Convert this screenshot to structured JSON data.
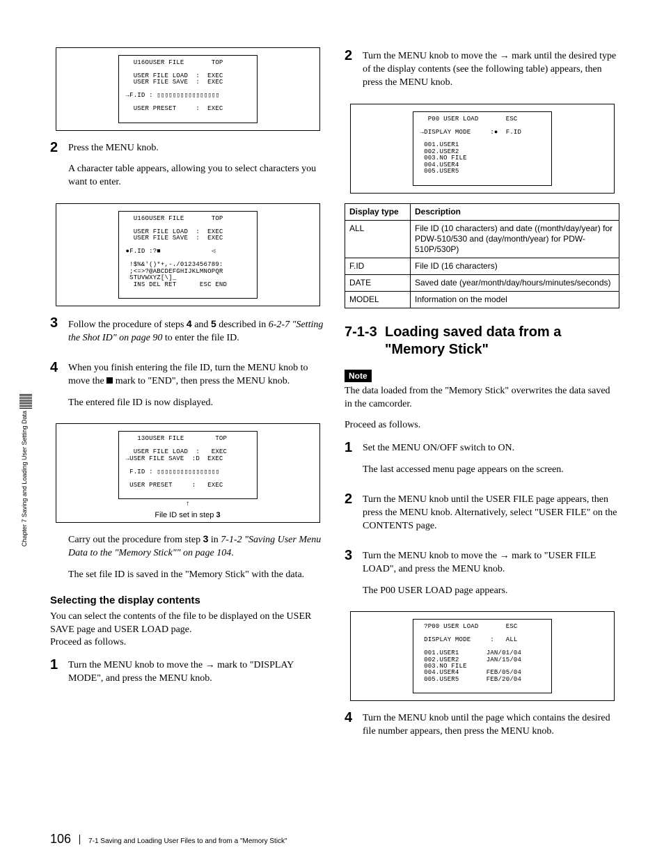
{
  "sideTab": "Chapter 7  Saving and Loading User Setting Data",
  "footer": {
    "page": "106",
    "sect": "7-1 Saving and Loading User Files to and from a \"Memory Stick\""
  },
  "left": {
    "screen1": "  U16OUSER FILE       TOP\n\n  USER FILE LOAD  :  EXEC\n  USER FILE SAVE  :  EXEC\n\n→F.ID : ▯▯▯▯▯▯▯▯▯▯▯▯▯▯▯▯\n\n  USER PRESET     :  EXEC",
    "step2a": {
      "num": "2",
      "text": "Press the MENU knob."
    },
    "step2a_p": "A character table appears, allowing you to select characters you want to enter.",
    "screen2": "  U16OUSER FILE       TOP\n\n  USER FILE LOAD  :  EXEC\n  USER FILE SAVE  :  EXEC\n\n●F.ID :?■             ◁\n\n !$%&'()*+,-./0123456789:\n ;<=>?@ABCDEFGHIJKLMNOPQR\n STUVWXYZ[\\]_\n  INS DEL RET      ESC END",
    "step3": {
      "num": "3",
      "pre": "Follow the procedure of steps ",
      "b1": "4",
      "mid": " and ",
      "b2": "5",
      "mid2": " described in ",
      "it": "6-2-7 \"Setting the Shot ID\" on page 90",
      "post": " to enter the file ID."
    },
    "step4": {
      "num": "4",
      "text1": "When you finish entering the file ID, turn the MENU knob to move the ",
      "text2": " mark to \"END\", then press the MENU knob.",
      "after": "The entered file ID is now displayed."
    },
    "screen3": "   13OUSER FILE        TOP\n\n  USER FILE LOAD  :   EXEC\n→USER FILE SAVE  :D  EXEC\n\n F.ID : ▯▯▯▯▯▯▯▯▯▯▯▯▯▯▯▯\n\n USER PRESET     :   EXEC",
    "screen3Note": "↑",
    "screen3Caption": {
      "pre": "File ID set in step ",
      "b": "3"
    },
    "carry": {
      "pre": "Carry out the procedure from step ",
      "b": "3",
      "mid": " in ",
      "it": "7-1-2 \"Saving User Menu Data to the \"Memory Stick\"\" on page 104",
      "post": "."
    },
    "setFile": "The set file ID is saved in the \"Memory Stick\" with the data.",
    "subhead": "Selecting the display contents",
    "subpara": "You can select the contents of the file to be displayed on the USER SAVE page and USER LOAD page.\nProceed as follows.",
    "stepB1": {
      "num": "1",
      "text": "Turn the MENU knob to move the → mark to \"DISPLAY MODE\", and press the MENU knob."
    }
  },
  "right": {
    "step2": {
      "num": "2",
      "text": "Turn the MENU knob to move the → mark until the desired type of the display contents (see the following table) appears, then press the MENU knob."
    },
    "screenA": "  P00 USER LOAD       ESC\n\n→DISPLAY MODE     :●  F.ID\n\n 001.USER1\n 002.USER2\n 003.NO FILE\n 004.USER4\n 005.USER5",
    "table": {
      "head": [
        "Display type",
        "Description"
      ],
      "rows": [
        [
          "ALL",
          "File ID (10 characters) and date ((month/day/year) for PDW-510/530 and (day/month/year) for PDW-510P/530P)"
        ],
        [
          "F.ID",
          "File ID (16 characters)"
        ],
        [
          "DATE",
          "Saved date (year/month/day/hours/minutes/seconds)"
        ],
        [
          "MODEL",
          "Information on the model"
        ]
      ]
    },
    "section": {
      "num": "7-1-3",
      "title": "Loading saved data from a \"Memory Stick\""
    },
    "note": "Note",
    "noteText": "The data loaded from the \"Memory Stick\" overwrites the data saved in the camcorder.",
    "proceed": "Proceed as follows.",
    "s1": {
      "num": "1",
      "a": "Set the MENU ON/OFF switch to ON.",
      "b": "The last accessed menu page appears on the screen."
    },
    "s2": {
      "num": "2",
      "a": "Turn the MENU knob until the USER FILE page appears, then press the MENU knob. Alternatively, select \"USER FILE\" on the CONTENTS page."
    },
    "s3": {
      "num": "3",
      "a": "Turn the MENU knob to move the → mark to \"USER FILE LOAD\", and press the MENU knob.",
      "b": "The P00 USER LOAD page appears."
    },
    "screenB": " ?P00 USER LOAD       ESC\n\n DISPLAY MODE     :   ALL\n\n 001.USER1       JAN/01/04\n 002.USER2       JAN/15/04\n 003.NO FILE\n 004.USER4       FEB/05/04\n 005.USER5       FEB/20/04",
    "s4": {
      "num": "4",
      "a": "Turn the MENU knob until the page which contains the desired file number appears, then press the MENU knob."
    }
  }
}
